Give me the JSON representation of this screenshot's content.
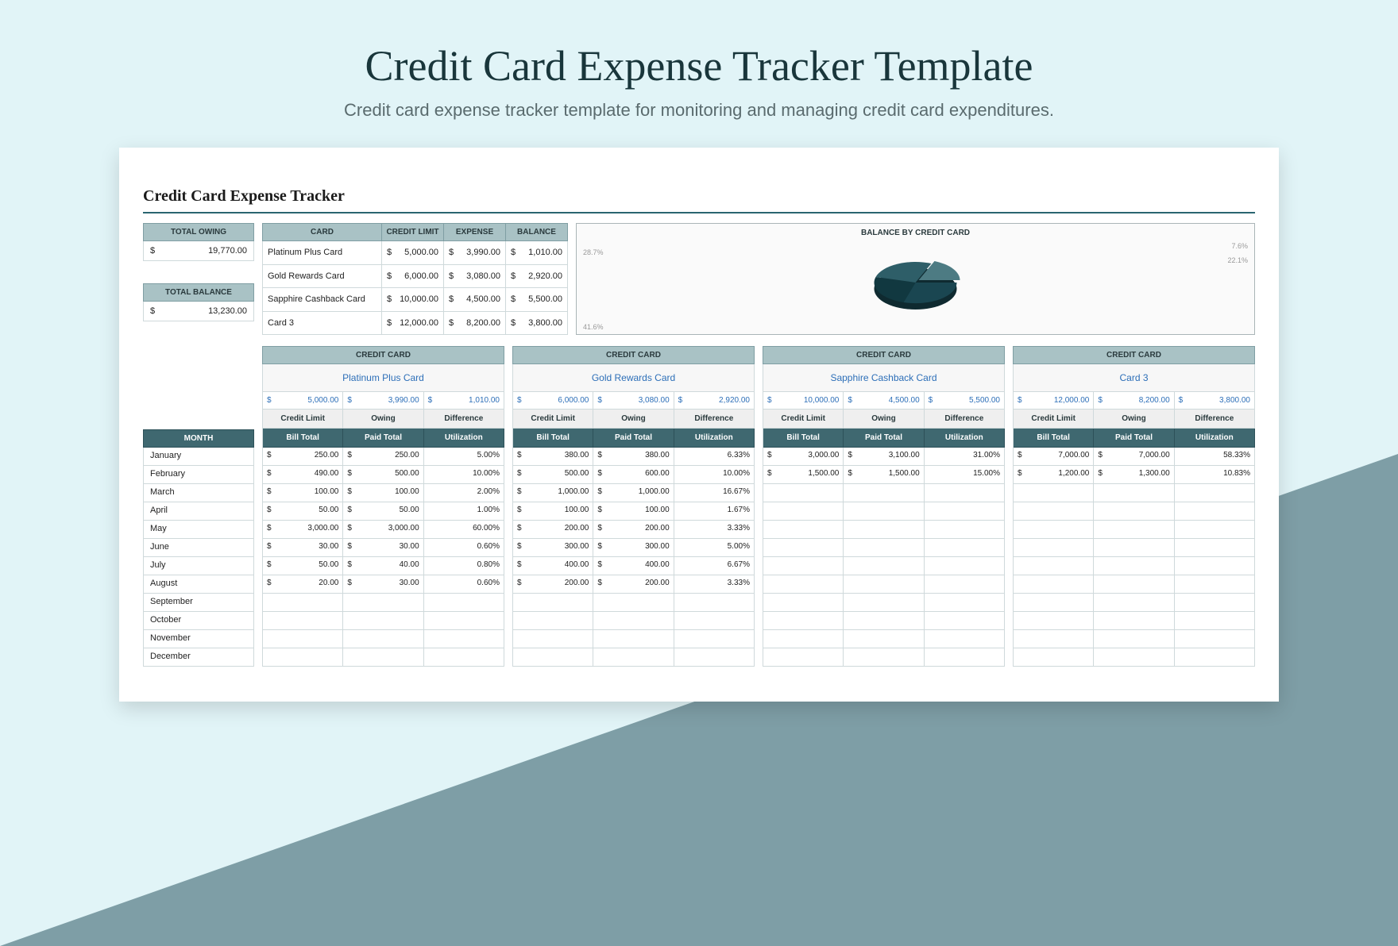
{
  "page": {
    "title": "Credit Card Expense Tracker Template",
    "subtitle": "Credit card expense tracker template for monitoring and managing credit card expenditures.",
    "sheet_title": "Credit Card Expense Tracker"
  },
  "totals": {
    "owing_label": "TOTAL OWING",
    "owing_value": "19,770.00",
    "balance_label": "TOTAL BALANCE",
    "balance_value": "13,230.00"
  },
  "summary": {
    "headers": {
      "card": "CARD",
      "limit": "CREDIT LIMIT",
      "expense": "EXPENSE",
      "balance": "BALANCE"
    },
    "rows": [
      {
        "card": "Platinum Plus Card",
        "limit": "5,000.00",
        "expense": "3,990.00",
        "balance": "1,010.00"
      },
      {
        "card": "Gold Rewards Card",
        "limit": "6,000.00",
        "expense": "3,080.00",
        "balance": "2,920.00"
      },
      {
        "card": "Sapphire Cashback Card",
        "limit": "10,000.00",
        "expense": "4,500.00",
        "balance": "5,500.00"
      },
      {
        "card": "Card 3",
        "limit": "12,000.00",
        "expense": "8,200.00",
        "balance": "3,800.00"
      }
    ]
  },
  "chart_data": {
    "type": "pie",
    "title": "BALANCE BY CREDIT CARD",
    "categories": [
      "Platinum Plus Card",
      "Gold Rewards Card",
      "Sapphire Cashback Card",
      "Card 3"
    ],
    "values": [
      7.6,
      22.1,
      41.6,
      28.7
    ],
    "labels": {
      "tl": "28.7%",
      "tr": "7.6%",
      "r": "22.1%",
      "bl": "41.6%"
    }
  },
  "months": {
    "header": "MONTH",
    "list": [
      "January",
      "February",
      "March",
      "April",
      "May",
      "June",
      "July",
      "August",
      "September",
      "October",
      "November",
      "December"
    ]
  },
  "card_columns": {
    "header": "CREDIT CARD",
    "labels1": {
      "limit": "Credit Limit",
      "owing": "Owing",
      "diff": "Difference"
    },
    "labels2": {
      "bill": "Bill Total",
      "paid": "Paid Total",
      "util": "Utilization"
    }
  },
  "cards": [
    {
      "name": "Platinum Plus Card",
      "limit": "5,000.00",
      "owing": "3,990.00",
      "diff": "1,010.00",
      "rows": [
        {
          "bill": "250.00",
          "paid": "250.00",
          "util": "5.00%"
        },
        {
          "bill": "490.00",
          "paid": "500.00",
          "util": "10.00%"
        },
        {
          "bill": "100.00",
          "paid": "100.00",
          "util": "2.00%"
        },
        {
          "bill": "50.00",
          "paid": "50.00",
          "util": "1.00%"
        },
        {
          "bill": "3,000.00",
          "paid": "3,000.00",
          "util": "60.00%"
        },
        {
          "bill": "30.00",
          "paid": "30.00",
          "util": "0.60%"
        },
        {
          "bill": "50.00",
          "paid": "40.00",
          "util": "0.80%"
        },
        {
          "bill": "20.00",
          "paid": "30.00",
          "util": "0.60%"
        },
        {},
        {},
        {},
        {}
      ]
    },
    {
      "name": "Gold Rewards Card",
      "limit": "6,000.00",
      "owing": "3,080.00",
      "diff": "2,920.00",
      "rows": [
        {
          "bill": "380.00",
          "paid": "380.00",
          "util": "6.33%"
        },
        {
          "bill": "500.00",
          "paid": "600.00",
          "util": "10.00%"
        },
        {
          "bill": "1,000.00",
          "paid": "1,000.00",
          "util": "16.67%"
        },
        {
          "bill": "100.00",
          "paid": "100.00",
          "util": "1.67%"
        },
        {
          "bill": "200.00",
          "paid": "200.00",
          "util": "3.33%"
        },
        {
          "bill": "300.00",
          "paid": "300.00",
          "util": "5.00%"
        },
        {
          "bill": "400.00",
          "paid": "400.00",
          "util": "6.67%"
        },
        {
          "bill": "200.00",
          "paid": "200.00",
          "util": "3.33%"
        },
        {},
        {},
        {},
        {}
      ]
    },
    {
      "name": "Sapphire Cashback Card",
      "limit": "10,000.00",
      "owing": "4,500.00",
      "diff": "5,500.00",
      "rows": [
        {
          "bill": "3,000.00",
          "paid": "3,100.00",
          "util": "31.00%"
        },
        {
          "bill": "1,500.00",
          "paid": "1,500.00",
          "util": "15.00%"
        },
        {},
        {},
        {},
        {},
        {},
        {},
        {},
        {},
        {},
        {}
      ]
    },
    {
      "name": "Card 3",
      "limit": "12,000.00",
      "owing": "8,200.00",
      "diff": "3,800.00",
      "rows": [
        {
          "bill": "7,000.00",
          "paid": "7,000.00",
          "util": "58.33%"
        },
        {
          "bill": "1,200.00",
          "paid": "1,300.00",
          "util": "10.83%"
        },
        {},
        {},
        {},
        {},
        {},
        {},
        {},
        {},
        {},
        {}
      ]
    }
  ]
}
